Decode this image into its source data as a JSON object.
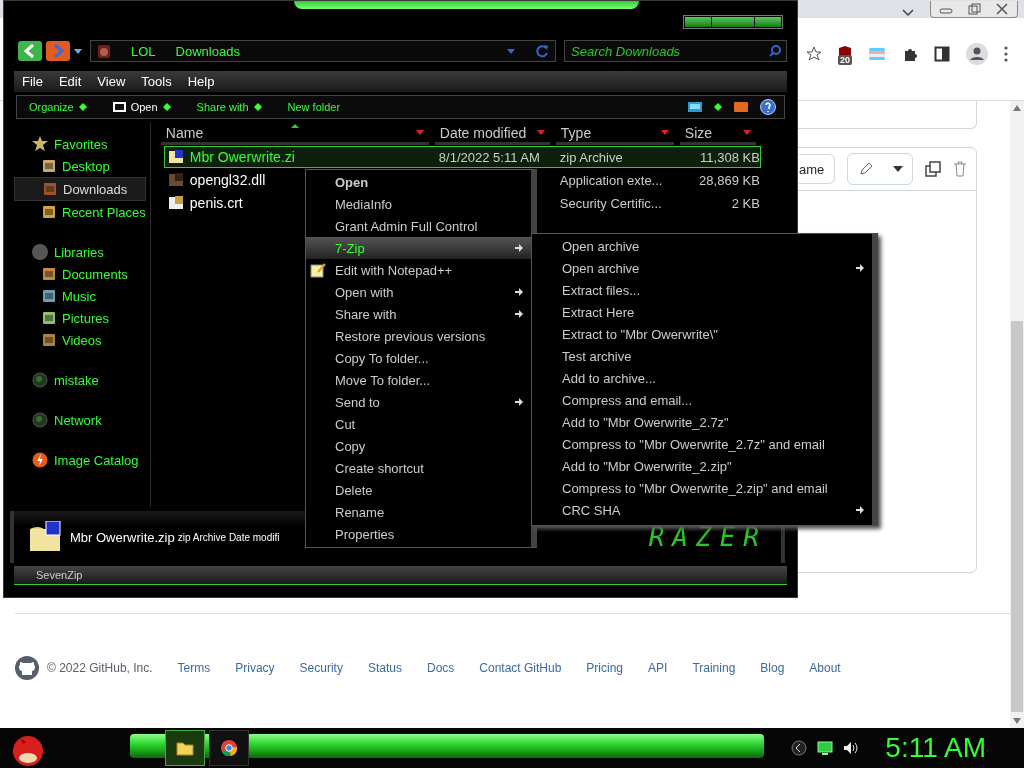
{
  "browser": {
    "extension_badge": "20",
    "card_button": "ame",
    "footer": {
      "copyright": "© 2022 GitHub, Inc.",
      "links": [
        "Terms",
        "Privacy",
        "Security",
        "Status",
        "Docs",
        "Contact GitHub",
        "Pricing",
        "API",
        "Training",
        "Blog",
        "About"
      ]
    }
  },
  "explorer": {
    "address": [
      "LOL",
      "Downloads"
    ],
    "search": {
      "placeholder": "Search Downloads"
    },
    "menu_bar": [
      "File",
      "Edit",
      "View",
      "Tools",
      "Help"
    ],
    "command_bar": [
      {
        "label": "Organize",
        "kind": "dropdown"
      },
      {
        "label": "Open",
        "kind": "open"
      },
      {
        "label": "Share with",
        "kind": "dropdown"
      },
      {
        "label": "New folder",
        "kind": "plain"
      }
    ],
    "sidebar": [
      {
        "label": "Favorites",
        "children": [
          {
            "label": "Desktop",
            "selected": false
          },
          {
            "label": "Downloads",
            "selected": true
          },
          {
            "label": "Recent Places",
            "selected": false
          }
        ]
      },
      {
        "label": "Libraries",
        "children": [
          {
            "label": "Documents",
            "selected": false
          },
          {
            "label": "Music",
            "selected": false
          },
          {
            "label": "Pictures",
            "selected": false
          },
          {
            "label": "Videos",
            "selected": false
          }
        ]
      },
      {
        "label": "mistake"
      },
      {
        "label": "Network"
      },
      {
        "label": "Image Catalog"
      }
    ],
    "columns": [
      "Name",
      "Date modified",
      "Type",
      "Size"
    ],
    "files": [
      {
        "name": "Mbr Owerwrite.zi",
        "date": "8/1/2022 5:11 AM",
        "type": "zip Archive",
        "size": "11,308 KB",
        "selected": true
      },
      {
        "name": "opengl32.dll",
        "type": "Application exte...",
        "size": "28,869 KB",
        "selected": false
      },
      {
        "name": "penis.crt",
        "type": "Security Certific...",
        "size": "2 KB",
        "selected": false
      }
    ],
    "details": {
      "name": "Mbr Owerwrite.zip",
      "info": "zip Archive Date modifi"
    },
    "logo": "RAZER",
    "status_bar": "SevenZip"
  },
  "context_menu": [
    {
      "label": "Open",
      "default": true,
      "selected": false,
      "submenu": false,
      "has_icon": false
    },
    {
      "label": "MediaInfo",
      "default": false,
      "selected": false,
      "submenu": false,
      "has_icon": false
    },
    {
      "label": "Grant Admin Full Control",
      "default": false,
      "selected": false,
      "submenu": false,
      "has_icon": false
    },
    {
      "label": "7-Zip",
      "default": false,
      "selected": true,
      "submenu": true,
      "has_icon": false
    },
    {
      "label": "Edit with Notepad++",
      "default": false,
      "selected": false,
      "submenu": false,
      "has_icon": true
    },
    {
      "label": "Open with",
      "default": false,
      "selected": false,
      "submenu": true,
      "has_icon": false
    },
    {
      "label": "Share with",
      "default": false,
      "selected": false,
      "submenu": true,
      "has_icon": false
    },
    {
      "label": "Restore previous versions",
      "default": false,
      "selected": false,
      "submenu": false,
      "has_icon": false
    },
    {
      "label": "Copy To folder...",
      "default": false,
      "selected": false,
      "submenu": false,
      "has_icon": false
    },
    {
      "label": "Move To folder...",
      "default": false,
      "selected": false,
      "submenu": false,
      "has_icon": false
    },
    {
      "label": "Send to",
      "default": false,
      "selected": false,
      "submenu": true,
      "has_icon": false
    },
    {
      "label": "Cut",
      "default": false,
      "selected": false,
      "submenu": false,
      "has_icon": false
    },
    {
      "label": "Copy",
      "default": false,
      "selected": false,
      "submenu": false,
      "has_icon": false
    },
    {
      "label": "Create shortcut",
      "default": false,
      "selected": false,
      "submenu": false,
      "has_icon": false
    },
    {
      "label": "Delete",
      "default": false,
      "selected": false,
      "submenu": false,
      "has_icon": false
    },
    {
      "label": "Rename",
      "default": false,
      "selected": false,
      "submenu": false,
      "has_icon": false
    },
    {
      "label": "Properties",
      "default": false,
      "selected": false,
      "submenu": false,
      "has_icon": false
    }
  ],
  "submenu": [
    {
      "label": "Open archive",
      "submenu": false
    },
    {
      "label": "Open archive",
      "submenu": true
    },
    {
      "label": "Extract files...",
      "submenu": false
    },
    {
      "label": "Extract Here",
      "submenu": false
    },
    {
      "label": "Extract to \"Mbr Owerwrite\\\"",
      "submenu": false
    },
    {
      "label": "Test archive",
      "submenu": false
    },
    {
      "label": "Add to archive...",
      "submenu": false
    },
    {
      "label": "Compress and email...",
      "submenu": false
    },
    {
      "label": "Add to \"Mbr Owerwrite_2.7z\"",
      "submenu": false
    },
    {
      "label": "Compress to \"Mbr Owerwrite_2.7z\" and email",
      "submenu": false
    },
    {
      "label": "Add to \"Mbr Owerwrite_2.zip\"",
      "submenu": false
    },
    {
      "label": "Compress to \"Mbr Owerwrite_2.zip\" and email",
      "submenu": false
    },
    {
      "label": "CRC SHA",
      "submenu": true
    }
  ],
  "taskbar": {
    "clock": "5:11 AM"
  }
}
